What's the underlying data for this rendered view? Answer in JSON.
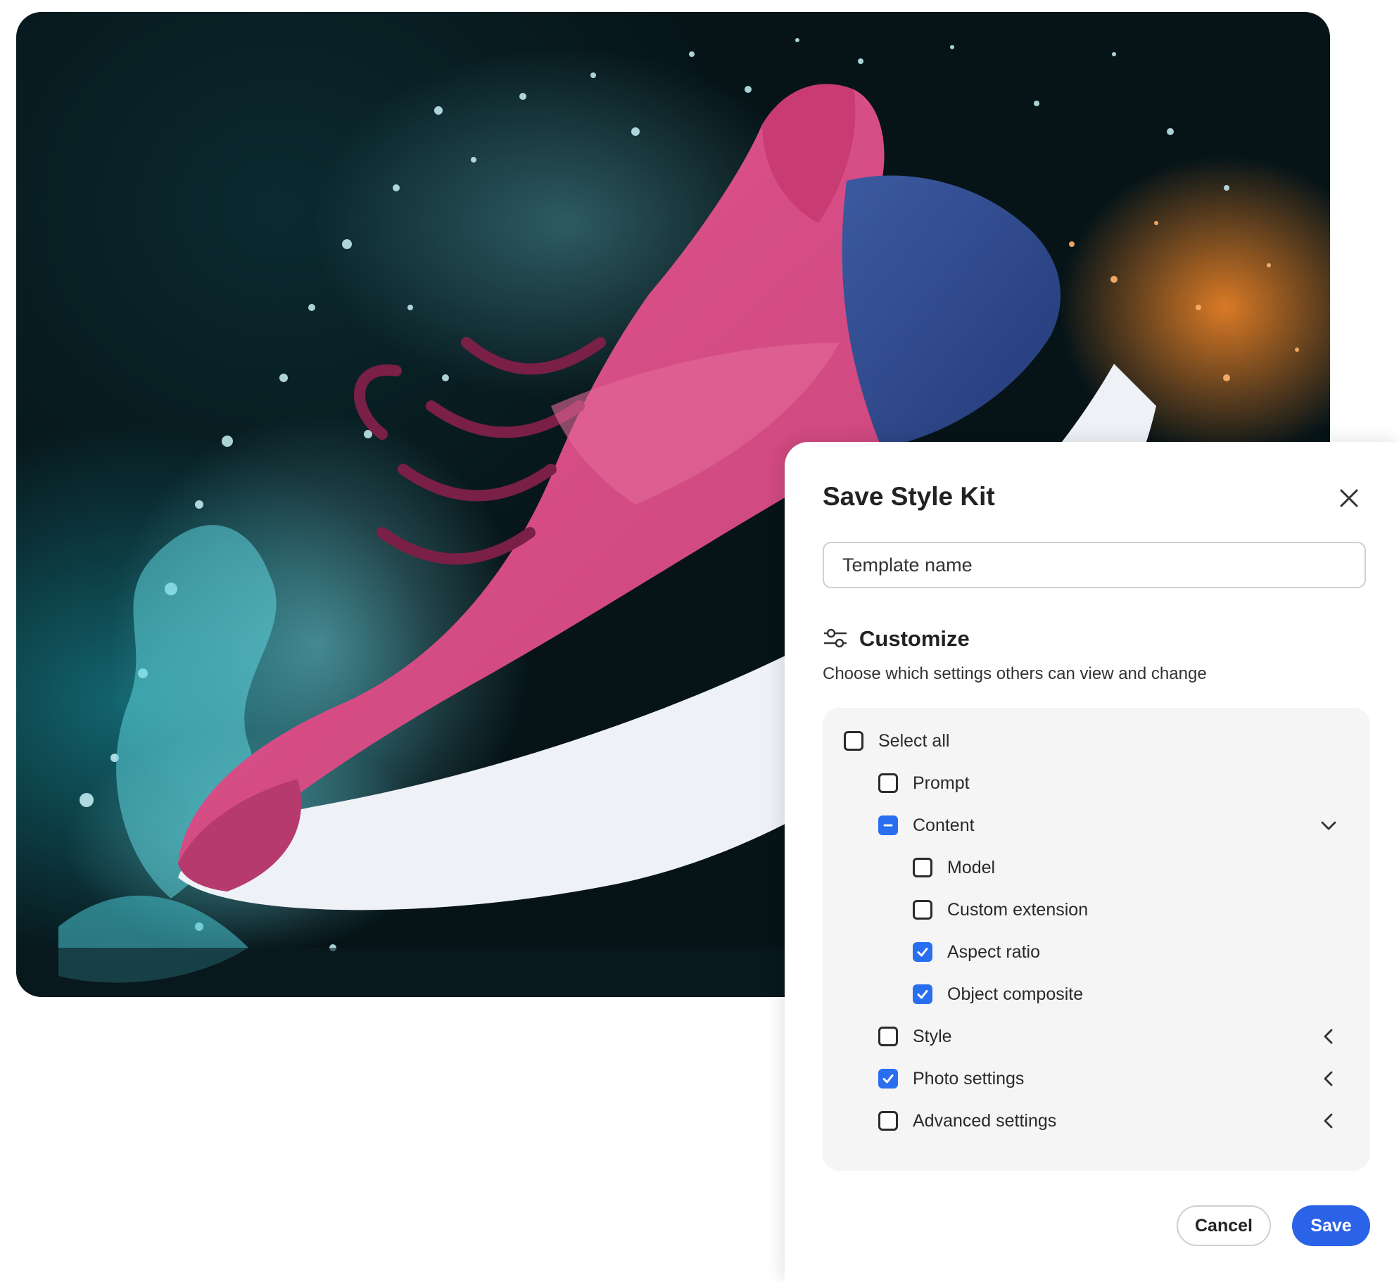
{
  "dialog": {
    "title": "Save Style Kit",
    "template_name_placeholder": "Template name",
    "customize": {
      "title": "Customize",
      "description": "Choose which settings others can view and change"
    },
    "options": {
      "select_all": {
        "label": "Select all",
        "state": "unchecked"
      },
      "prompt": {
        "label": "Prompt",
        "state": "unchecked"
      },
      "content": {
        "label": "Content",
        "state": "mixed",
        "expanded": true
      },
      "model": {
        "label": "Model",
        "state": "unchecked"
      },
      "custom_extension": {
        "label": "Custom extension",
        "state": "unchecked"
      },
      "aspect_ratio": {
        "label": "Aspect ratio",
        "state": "checked"
      },
      "object_composite": {
        "label": "Object composite",
        "state": "checked"
      },
      "style": {
        "label": "Style",
        "state": "unchecked",
        "expanded": false
      },
      "photo_settings": {
        "label": "Photo settings",
        "state": "checked",
        "expanded": false
      },
      "advanced_settings": {
        "label": "Advanced settings",
        "state": "unchecked",
        "expanded": false
      }
    },
    "cancel_label": "Cancel",
    "save_label": "Save"
  },
  "colors": {
    "accent": "#2a62e8",
    "checkbox_checked": "#2a6ef0",
    "panel_bg": "#f5f5f5"
  },
  "icons": [
    "close-icon",
    "sliders-icon",
    "chevron-down-icon",
    "chevron-left-icon",
    "checkmark-icon",
    "dash-icon"
  ]
}
